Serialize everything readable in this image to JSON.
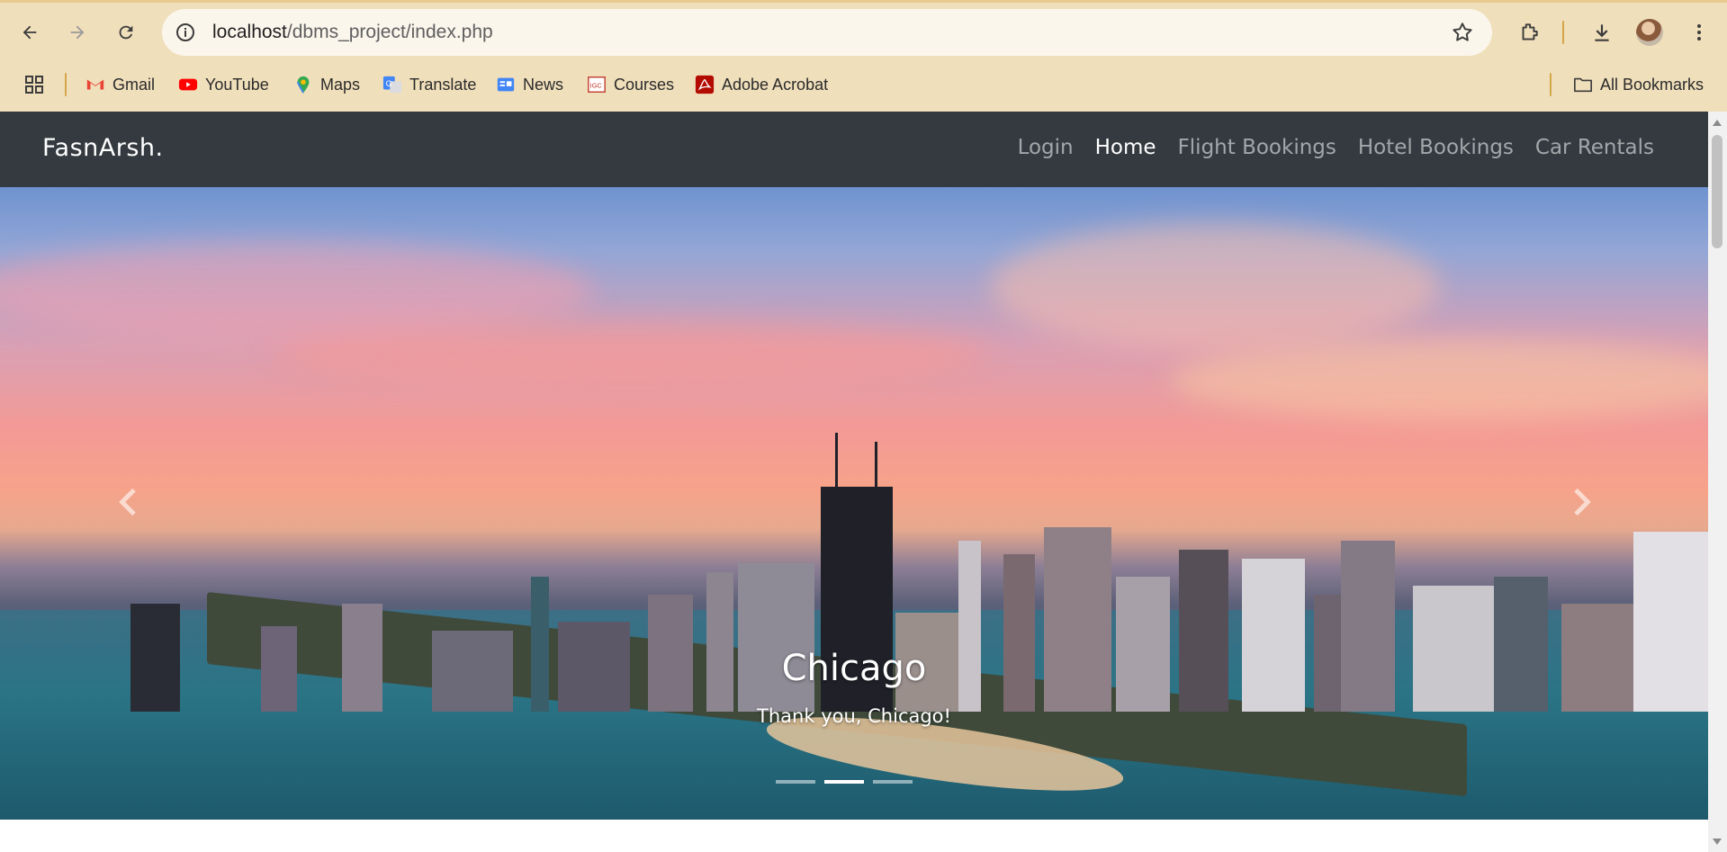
{
  "browser": {
    "url_host": "localhost",
    "url_path": "/dbms_project/index.php",
    "bookmarks": [
      {
        "label": "Gmail",
        "icon": "gmail-icon"
      },
      {
        "label": "YouTube",
        "icon": "youtube-icon"
      },
      {
        "label": "Maps",
        "icon": "maps-icon"
      },
      {
        "label": "Translate",
        "icon": "translate-icon"
      },
      {
        "label": "News",
        "icon": "news-icon"
      },
      {
        "label": "Courses",
        "icon": "courses-icon"
      },
      {
        "label": "Adobe Acrobat",
        "icon": "acrobat-icon"
      }
    ],
    "all_bookmarks_label": "All Bookmarks"
  },
  "site": {
    "brand": "FasnArsh.",
    "nav": [
      {
        "label": "Login",
        "active": false
      },
      {
        "label": "Home",
        "active": true
      },
      {
        "label": "Flight Bookings",
        "active": false
      },
      {
        "label": "Hotel Bookings",
        "active": false
      },
      {
        "label": "Car Rentals",
        "active": false
      }
    ]
  },
  "carousel": {
    "title": "Chicago",
    "subtitle": "Thank you, Chicago!",
    "slide_count": 3,
    "active_index": 1
  },
  "colors": {
    "navbar": "#343a40",
    "browser_chrome": "#f0dfbb"
  }
}
